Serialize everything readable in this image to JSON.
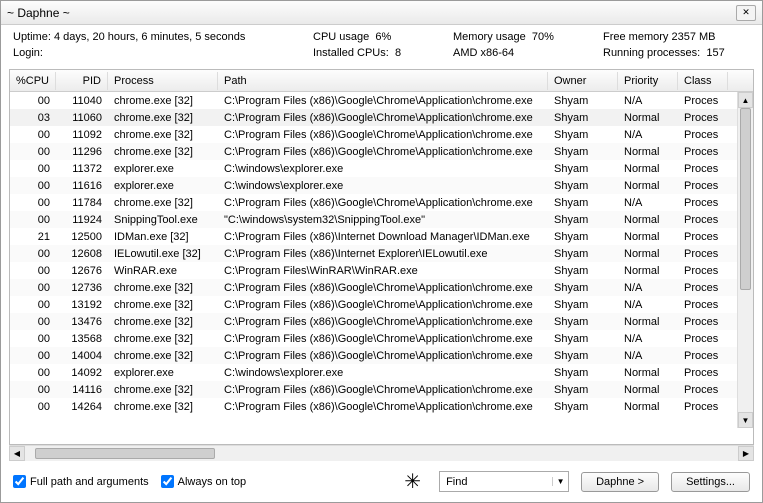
{
  "window": {
    "title": "~ Daphne ~"
  },
  "stats": {
    "uptime_label": "Uptime:",
    "uptime_value": "4 days, 20 hours,  6 minutes,  5 seconds",
    "cpu_usage_label": "CPU usage",
    "cpu_usage_value": "6%",
    "mem_usage_label": "Memory usage",
    "mem_usage_value": "70%",
    "free_mem_label": "Free memory",
    "free_mem_value": "2357 MB",
    "login_label": "Login:",
    "login_value": "",
    "installed_cpus_label": "Installed CPUs:",
    "installed_cpus_value": "8",
    "arch_label": "AMD x86-64",
    "running_procs_label": "Running processes:",
    "running_procs_value": "157"
  },
  "columns": {
    "cpu": "%CPU",
    "pid": "PID",
    "process": "Process",
    "path": "Path",
    "owner": "Owner",
    "priority": "Priority",
    "class": "Class"
  },
  "rows": [
    {
      "cpu": "00",
      "pid": "11040",
      "proc": "chrome.exe [32]",
      "path": "C:\\Program Files (x86)\\Google\\Chrome\\Application\\chrome.exe",
      "owner": "Shyam",
      "prio": "N/A",
      "class": "Proces"
    },
    {
      "cpu": "03",
      "pid": "11060",
      "proc": "chrome.exe [32]",
      "path": "C:\\Program Files (x86)\\Google\\Chrome\\Application\\chrome.exe",
      "owner": "Shyam",
      "prio": "Normal",
      "class": "Proces",
      "selected": true
    },
    {
      "cpu": "00",
      "pid": "11092",
      "proc": "chrome.exe [32]",
      "path": "C:\\Program Files (x86)\\Google\\Chrome\\Application\\chrome.exe",
      "owner": "Shyam",
      "prio": "N/A",
      "class": "Proces"
    },
    {
      "cpu": "00",
      "pid": "11296",
      "proc": "chrome.exe [32]",
      "path": "C:\\Program Files (x86)\\Google\\Chrome\\Application\\chrome.exe",
      "owner": "Shyam",
      "prio": "Normal",
      "class": "Proces"
    },
    {
      "cpu": "00",
      "pid": "11372",
      "proc": "explorer.exe",
      "path": "C:\\windows\\explorer.exe",
      "owner": "Shyam",
      "prio": "Normal",
      "class": "Proces"
    },
    {
      "cpu": "00",
      "pid": "11616",
      "proc": "explorer.exe",
      "path": "C:\\windows\\explorer.exe",
      "owner": "Shyam",
      "prio": "Normal",
      "class": "Proces"
    },
    {
      "cpu": "00",
      "pid": "11784",
      "proc": "chrome.exe [32]",
      "path": "C:\\Program Files (x86)\\Google\\Chrome\\Application\\chrome.exe",
      "owner": "Shyam",
      "prio": "N/A",
      "class": "Proces"
    },
    {
      "cpu": "00",
      "pid": "11924",
      "proc": "SnippingTool.exe",
      "path": "\"C:\\windows\\system32\\SnippingTool.exe\"",
      "owner": "Shyam",
      "prio": "Normal",
      "class": "Proces"
    },
    {
      "cpu": "21",
      "pid": "12500",
      "proc": "IDMan.exe [32]",
      "path": "C:\\Program Files (x86)\\Internet Download Manager\\IDMan.exe",
      "owner": "Shyam",
      "prio": "Normal",
      "class": "Proces"
    },
    {
      "cpu": "00",
      "pid": "12608",
      "proc": "IELowutil.exe [32]",
      "path": "C:\\Program Files (x86)\\Internet Explorer\\IELowutil.exe",
      "owner": "Shyam",
      "prio": "Normal",
      "class": "Proces"
    },
    {
      "cpu": "00",
      "pid": "12676",
      "proc": "WinRAR.exe",
      "path": "C:\\Program Files\\WinRAR\\WinRAR.exe",
      "owner": "Shyam",
      "prio": "Normal",
      "class": "Proces"
    },
    {
      "cpu": "00",
      "pid": "12736",
      "proc": "chrome.exe [32]",
      "path": "C:\\Program Files (x86)\\Google\\Chrome\\Application\\chrome.exe",
      "owner": "Shyam",
      "prio": "N/A",
      "class": "Proces"
    },
    {
      "cpu": "00",
      "pid": "13192",
      "proc": "chrome.exe [32]",
      "path": "C:\\Program Files (x86)\\Google\\Chrome\\Application\\chrome.exe",
      "owner": "Shyam",
      "prio": "N/A",
      "class": "Proces"
    },
    {
      "cpu": "00",
      "pid": "13476",
      "proc": "chrome.exe [32]",
      "path": "C:\\Program Files (x86)\\Google\\Chrome\\Application\\chrome.exe",
      "owner": "Shyam",
      "prio": "Normal",
      "class": "Proces"
    },
    {
      "cpu": "00",
      "pid": "13568",
      "proc": "chrome.exe [32]",
      "path": "C:\\Program Files (x86)\\Google\\Chrome\\Application\\chrome.exe",
      "owner": "Shyam",
      "prio": "N/A",
      "class": "Proces"
    },
    {
      "cpu": "00",
      "pid": "14004",
      "proc": "chrome.exe [32]",
      "path": "C:\\Program Files (x86)\\Google\\Chrome\\Application\\chrome.exe",
      "owner": "Shyam",
      "prio": "N/A",
      "class": "Proces"
    },
    {
      "cpu": "00",
      "pid": "14092",
      "proc": "explorer.exe",
      "path": "C:\\windows\\explorer.exe",
      "owner": "Shyam",
      "prio": "Normal",
      "class": "Proces"
    },
    {
      "cpu": "00",
      "pid": "14116",
      "proc": "chrome.exe [32]",
      "path": "C:\\Program Files (x86)\\Google\\Chrome\\Application\\chrome.exe",
      "owner": "Shyam",
      "prio": "Normal",
      "class": "Proces"
    },
    {
      "cpu": "00",
      "pid": "14264",
      "proc": "chrome.exe [32]",
      "path": "C:\\Program Files (x86)\\Google\\Chrome\\Application\\chrome.exe",
      "owner": "Shyam",
      "prio": "Normal",
      "class": "Proces"
    }
  ],
  "footer": {
    "full_path_label": "Full path and arguments",
    "always_on_top_label": "Always on top",
    "find_label": "Find",
    "daphne_btn": "Daphne >",
    "settings_btn": "Settings..."
  }
}
